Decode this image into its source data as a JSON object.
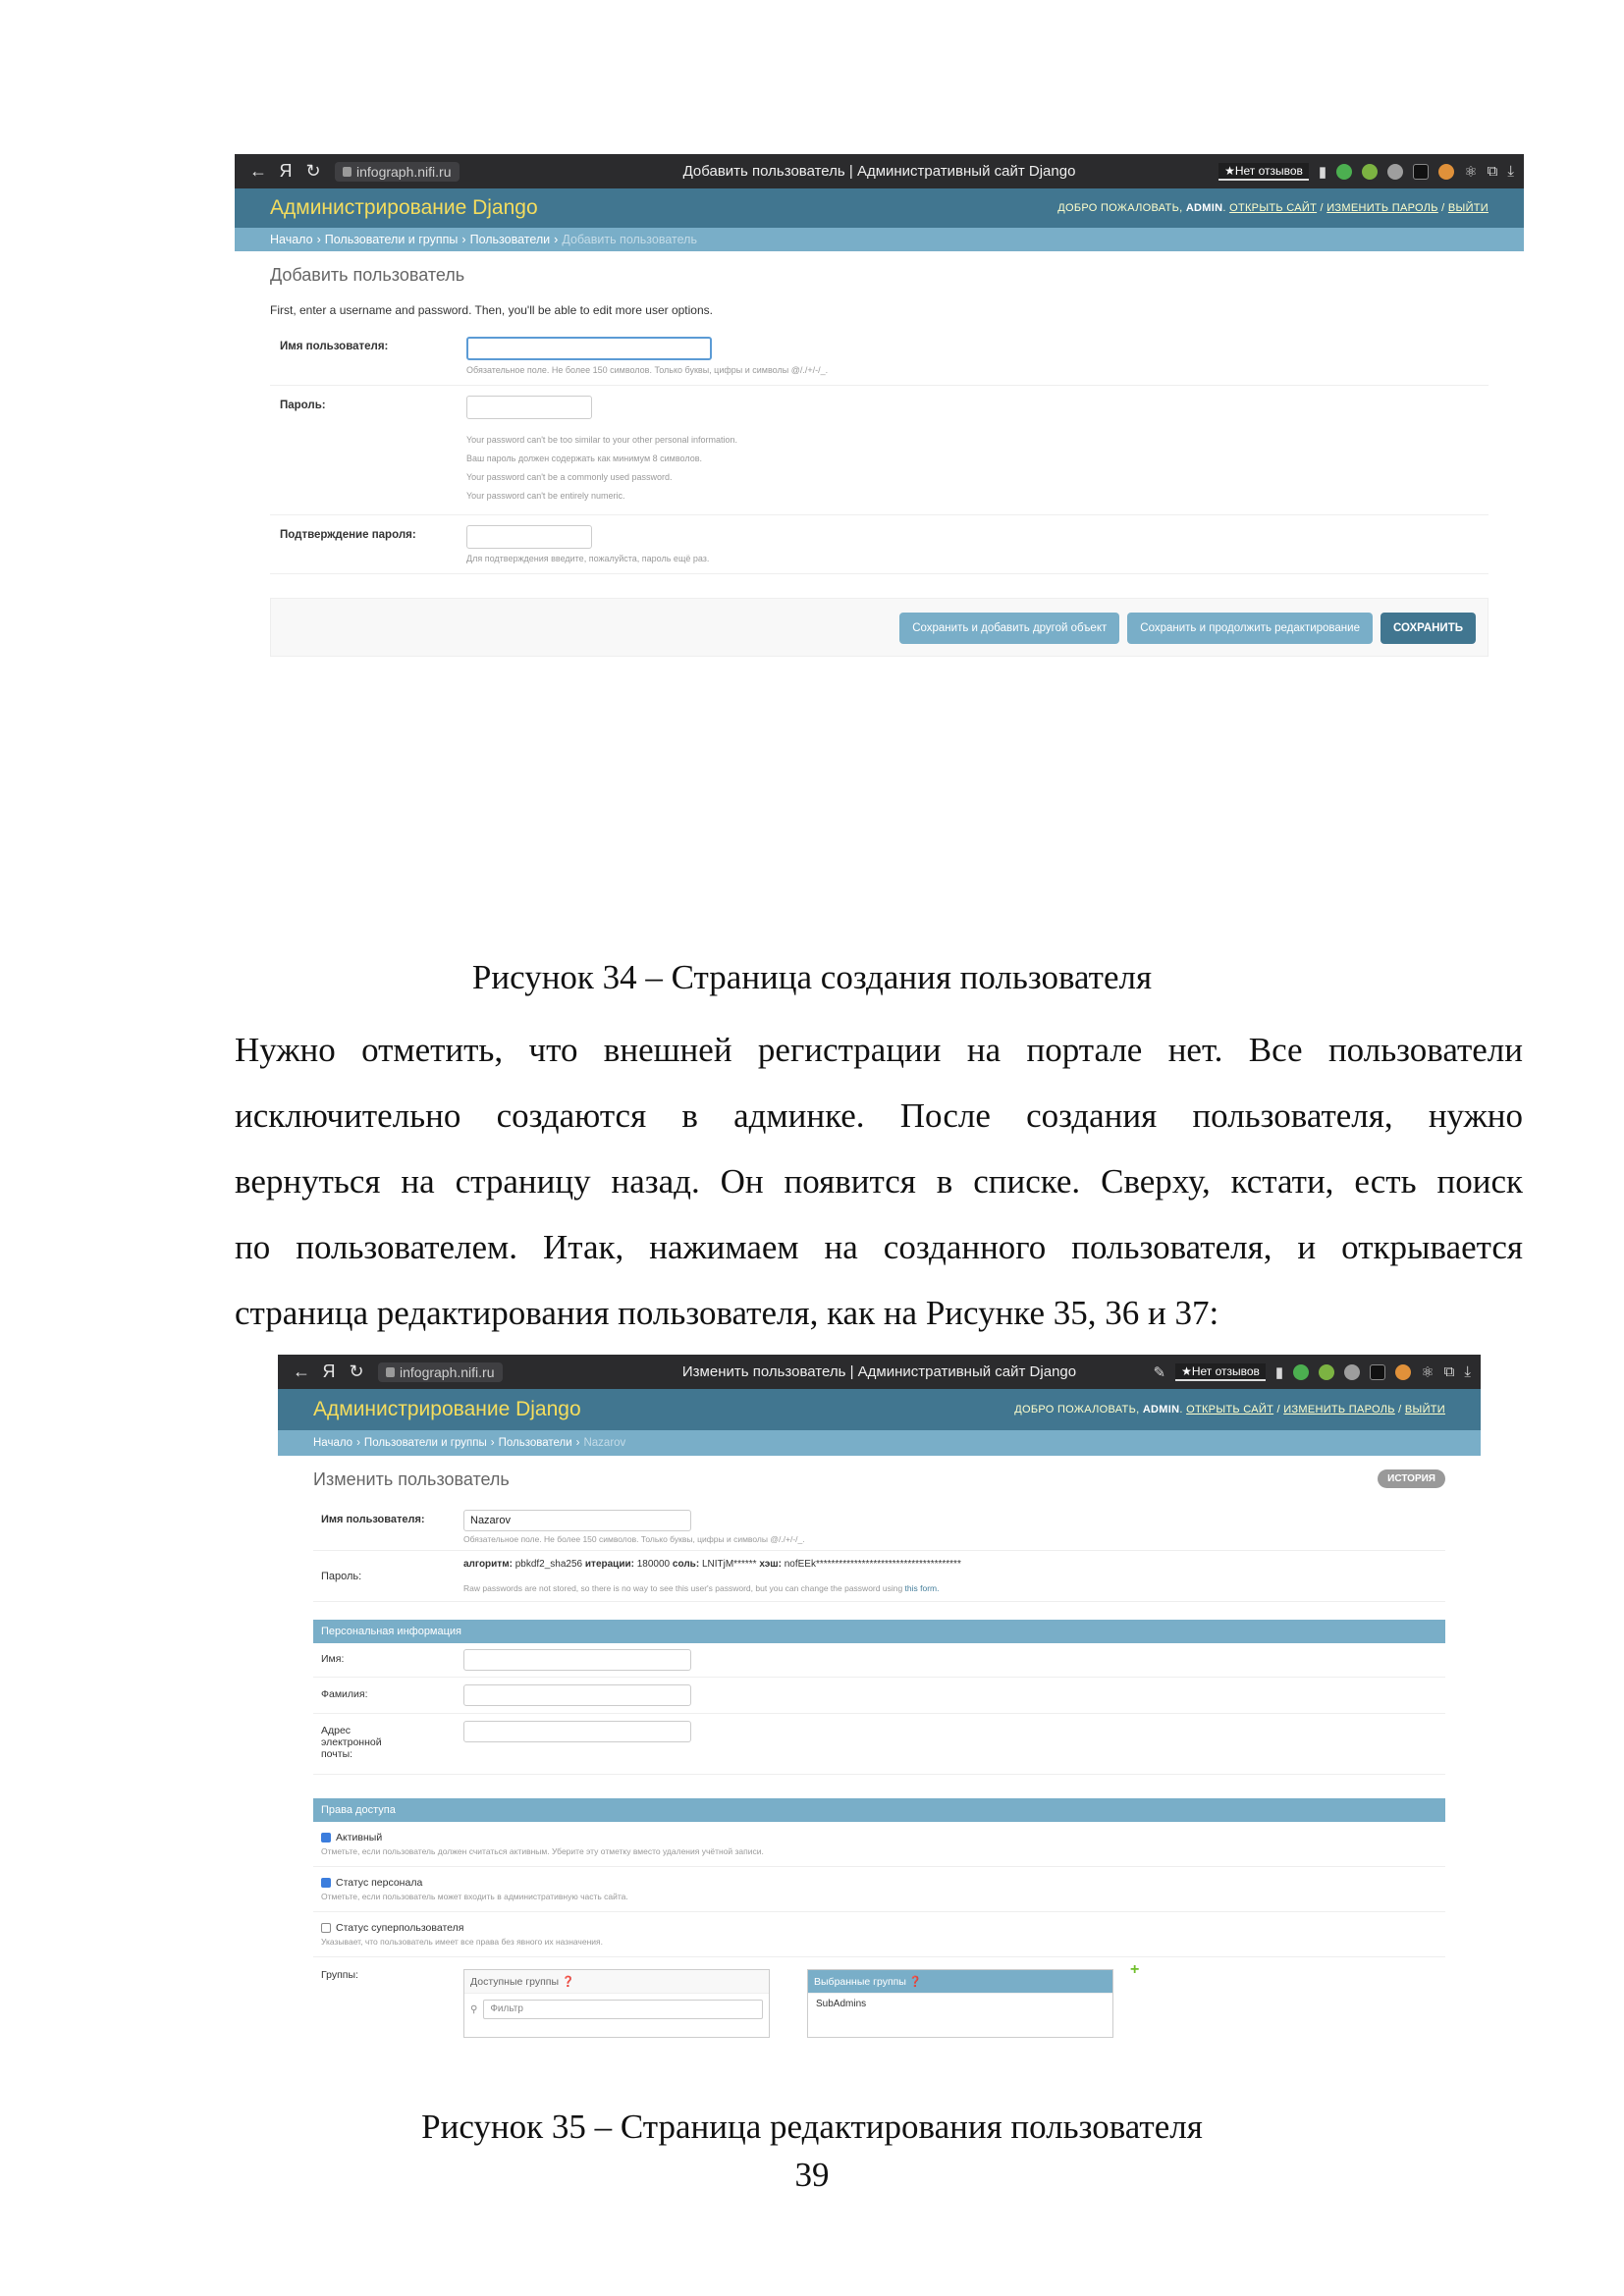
{
  "screenshot1": {
    "browser": {
      "host": "infograph.nifi.ru",
      "tab_title": "Добавить пользователь | Административный сайт Django",
      "reviews": "Нет отзывов"
    },
    "header": {
      "brand": "Администрирование Django",
      "welcome": "ДОБРО ПОЖАЛОВАТЬ,",
      "user": "ADMIN",
      "open_site": "ОТКРЫТЬ САЙТ",
      "change_password": "ИЗМЕНИТЬ ПАРОЛЬ",
      "logout": "ВЫЙТИ",
      "sep": "/"
    },
    "breadcrumbs": {
      "home": "Начало",
      "app": "Пользователи и группы",
      "model": "Пользователи",
      "current": "Добавить пользователь",
      "sep": "›"
    },
    "title": "Добавить пользователь",
    "intro": "First, enter a username and password. Then, you'll be able to edit more user options.",
    "fields": {
      "username": {
        "label": "Имя пользователя:",
        "help": "Обязательное поле. Не более 150 символов. Только буквы, цифры и символы @/./+/-/_."
      },
      "password": {
        "label": "Пароль:",
        "help": [
          "Your password can't be too similar to your other personal information.",
          "Ваш пароль должен содержать как минимум 8 символов.",
          "Your password can't be a commonly used password.",
          "Your password can't be entirely numeric."
        ]
      },
      "password2": {
        "label": "Подтверждение пароля:",
        "help": "Для подтверждения введите, пожалуйста, пароль ещё раз."
      }
    },
    "buttons": {
      "save_add": "Сохранить и добавить другой объект",
      "save_continue": "Сохранить и продолжить редактирование",
      "save": "СОХРАНИТЬ"
    }
  },
  "caption1": "Рисунок 34 – Страница создания пользователя",
  "paragraph": [
    "Нужно отметить, что внешней регистрации на портале нет. Все пользователи",
    "исключительно создаются в админке. После создания пользователя, нужно",
    "вернуться на страницу назад. Он появится в списке. Сверху, кстати, есть поиск",
    "по пользователем. Итак, нажимаем на созданного пользователя, и открывается",
    "страница редактирования пользователя, как на Рисунке 35, 36 и 37:"
  ],
  "screenshot2": {
    "browser": {
      "host": "infograph.nifi.ru",
      "tab_title": "Изменить пользователь | Административный сайт Django",
      "reviews": "Нет отзывов"
    },
    "header": {
      "brand": "Администрирование Django",
      "welcome": "ДОБРО ПОЖАЛОВАТЬ,",
      "user": "ADMIN",
      "open_site": "ОТКРЫТЬ САЙТ",
      "change_password": "ИЗМЕНИТЬ ПАРОЛЬ",
      "logout": "ВЫЙТИ",
      "sep": "/"
    },
    "breadcrumbs": {
      "home": "Начало",
      "app": "Пользователи и группы",
      "model": "Пользователи",
      "current": "Nazarov",
      "sep": "›"
    },
    "title": "Изменить пользователь",
    "history": "ИСТОРИЯ",
    "username": {
      "label": "Имя пользователя:",
      "value": "Nazarov",
      "help": "Обязательное поле. Не более 150 символов. Только буквы, цифры и символы @/./+/-/_."
    },
    "password": {
      "label": "Пароль:",
      "algo_label": "алгоритм:",
      "algo": "pbkdf2_sha256",
      "iter_label": "итерации:",
      "iter": "180000",
      "salt_label": "соль:",
      "salt": "LNITjM******",
      "hash_label": "хэш:",
      "hash": "nofEEk**************************************",
      "help": "Raw passwords are not stored, so there is no way to see this user's password, but you can change the password using",
      "link": "this form."
    },
    "personal": {
      "title": "Персональная информация",
      "first_name": "Имя:",
      "last_name": "Фамилия:",
      "email": "Адрес электронной почты:"
    },
    "perms": {
      "title": "Права доступа",
      "active": {
        "label": "Активный",
        "help": "Отметьте, если пользователь должен считаться активным. Уберите эту отметку вместо удаления учётной записи."
      },
      "staff": {
        "label": "Статус персонала",
        "help": "Отметьте, если пользователь может входить в административную часть сайта."
      },
      "superuser": {
        "label": "Статус суперпользователя",
        "help": "Указывает, что пользователь имеет все права без явного их назначения."
      }
    },
    "groups": {
      "label": "Группы:",
      "available": "Доступные группы",
      "filter": "Фильтр",
      "chosen": "Выбранные группы",
      "chosen_items": [
        "SubAdmins"
      ]
    }
  },
  "caption2": "Рисунок 35 – Страница редактирования пользователя",
  "page_number": "39"
}
